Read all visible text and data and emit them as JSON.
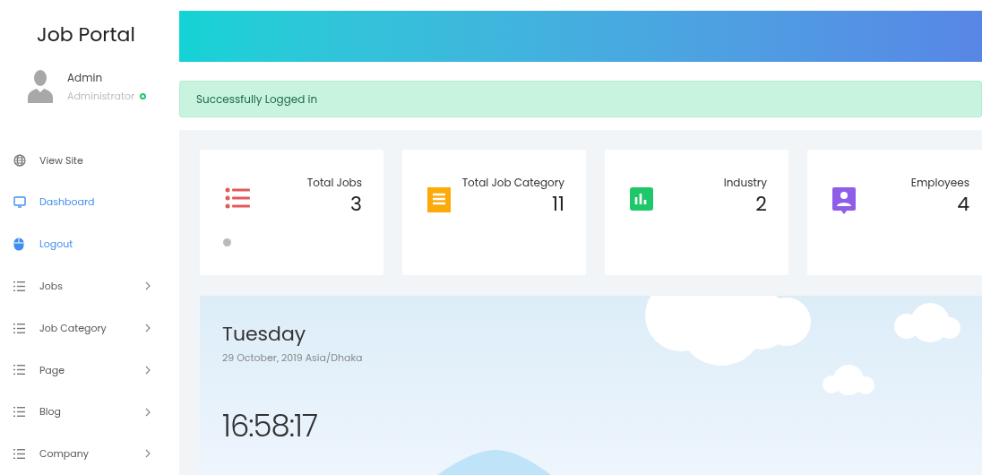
{
  "sidebar": {
    "brand": "Job Portal",
    "user": {
      "name": "Admin",
      "role": "Administrator",
      "online": true
    },
    "items": [
      {
        "kind": "site",
        "label": "View Site",
        "accent": false,
        "expandable": false
      },
      {
        "kind": "dashboard",
        "label": "Dashboard",
        "accent": true,
        "expandable": false
      },
      {
        "kind": "logout",
        "label": "Logout",
        "accent": true,
        "expandable": false
      },
      {
        "kind": "menu",
        "label": "Jobs",
        "accent": false,
        "expandable": true
      },
      {
        "kind": "menu",
        "label": "Job Category",
        "accent": false,
        "expandable": true
      },
      {
        "kind": "menu",
        "label": "Page",
        "accent": false,
        "expandable": true
      },
      {
        "kind": "menu",
        "label": "Blog",
        "accent": false,
        "expandable": true
      },
      {
        "kind": "menu",
        "label": "Company",
        "accent": false,
        "expandable": true
      }
    ]
  },
  "alert": {
    "message": "Successfully Logged in"
  },
  "stats": [
    {
      "kind": "list",
      "label": "Total Jobs",
      "value": "3",
      "color": "#e25a5a",
      "info": true
    },
    {
      "kind": "receipt",
      "label": "Total Job Category",
      "value": "11",
      "color": "#fbaa0a",
      "info": false
    },
    {
      "kind": "chart",
      "label": "Industry",
      "value": "2",
      "color": "#1ec86a",
      "info": false
    },
    {
      "kind": "person",
      "label": "Employees",
      "value": "4",
      "color": "#8e5ee8",
      "info": false
    }
  ],
  "weather": {
    "day": "Tuesday",
    "date": "29 October, 2019 Asia/Dhaka",
    "time": "16:58:17"
  }
}
